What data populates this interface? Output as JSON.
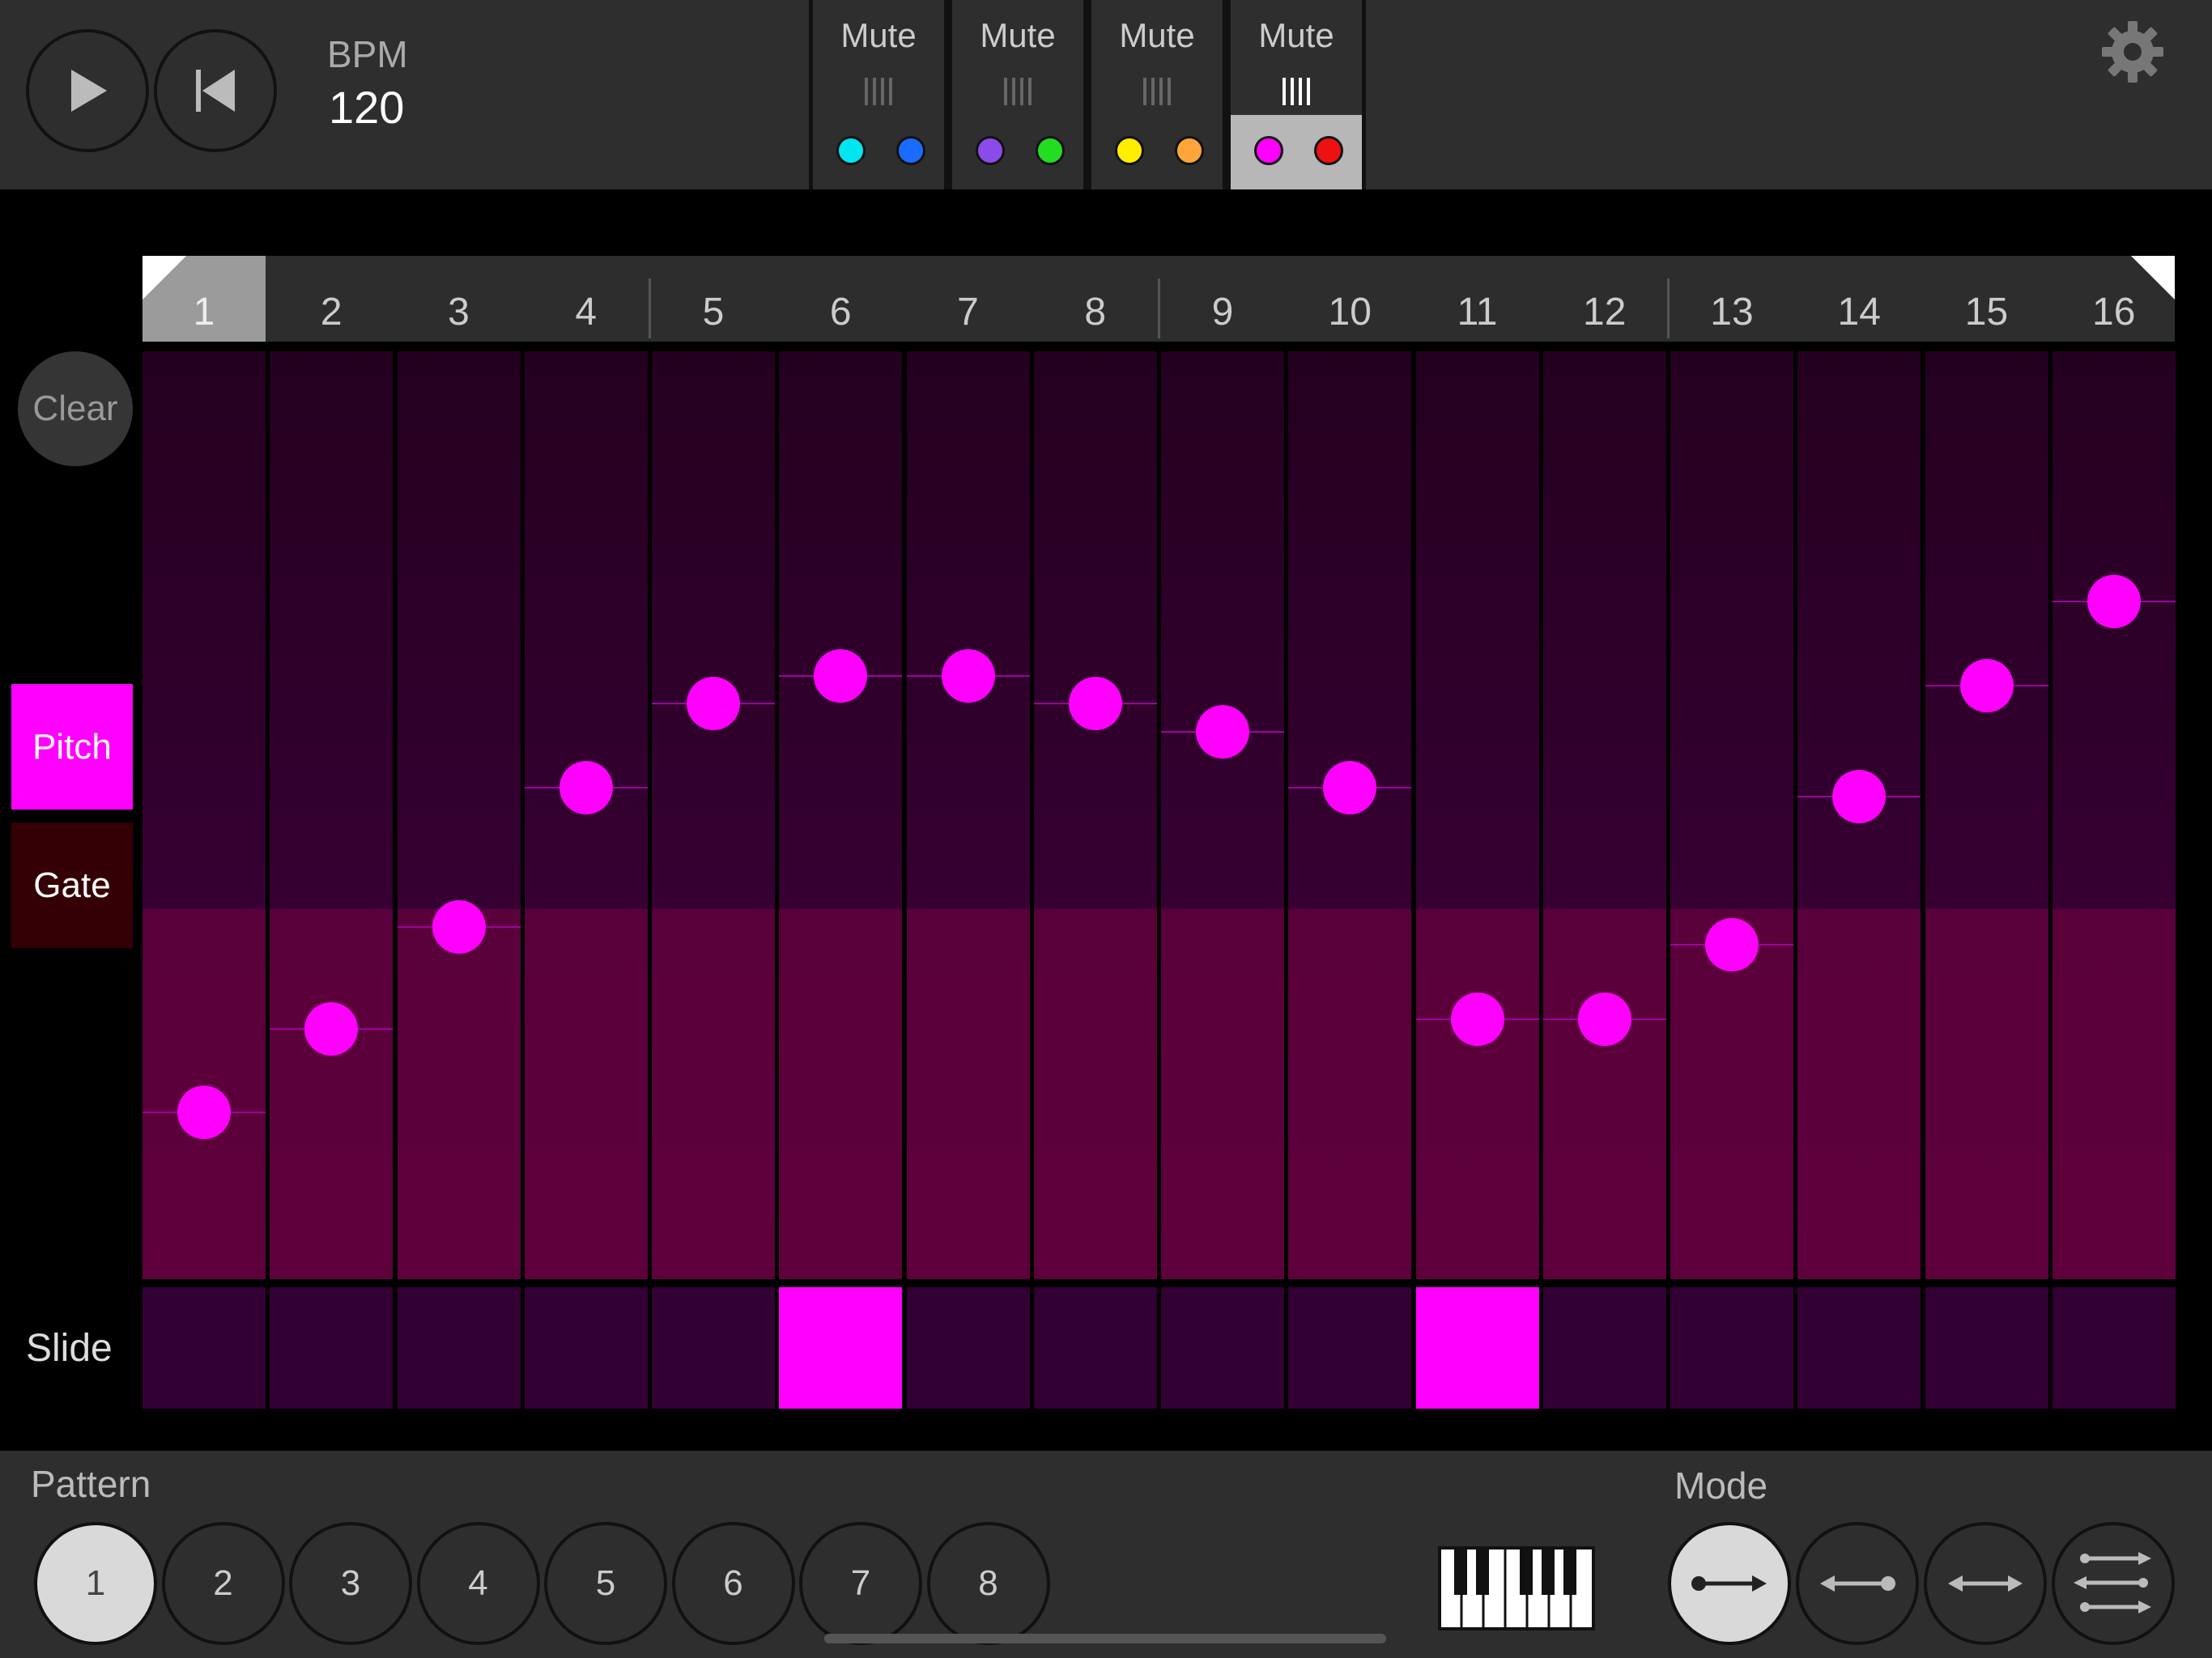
{
  "transport": {
    "bpm_label": "BPM",
    "bpm_value": "120"
  },
  "tracks": [
    {
      "mute_label": "Mute",
      "colors": [
        "#00e5f0",
        "#1b6bff"
      ],
      "selected": false
    },
    {
      "mute_label": "Mute",
      "colors": [
        "#8b4be8",
        "#22dd22"
      ],
      "selected": false
    },
    {
      "mute_label": "Mute",
      "colors": [
        "#ffee00",
        "#ffa53a"
      ],
      "selected": false
    },
    {
      "mute_label": "Mute",
      "colors": [
        "#ff00ff",
        "#ee1111"
      ],
      "selected": true
    }
  ],
  "steps": [
    "1",
    "2",
    "3",
    "4",
    "5",
    "6",
    "7",
    "8",
    "9",
    "10",
    "11",
    "12",
    "13",
    "14",
    "15",
    "16"
  ],
  "current_step": 1,
  "pitch_values": [
    0.18,
    0.27,
    0.38,
    0.53,
    0.62,
    0.65,
    0.65,
    0.62,
    0.59,
    0.53,
    0.28,
    0.28,
    0.36,
    0.52,
    0.64,
    0.73
  ],
  "slides": [
    false,
    false,
    false,
    false,
    false,
    true,
    false,
    false,
    false,
    false,
    true,
    false,
    false,
    false,
    false,
    false
  ],
  "sidebar": {
    "clear_label": "Clear",
    "pitch_label": "Pitch",
    "gate_label": "Gate",
    "slide_label": "Slide"
  },
  "pattern": {
    "label": "Pattern",
    "buttons": [
      "1",
      "2",
      "3",
      "4",
      "5",
      "6",
      "7",
      "8"
    ],
    "active": "1"
  },
  "mode": {
    "label": "Mode",
    "active_index": 0
  },
  "colors": {
    "accent": "#ff00ff"
  }
}
